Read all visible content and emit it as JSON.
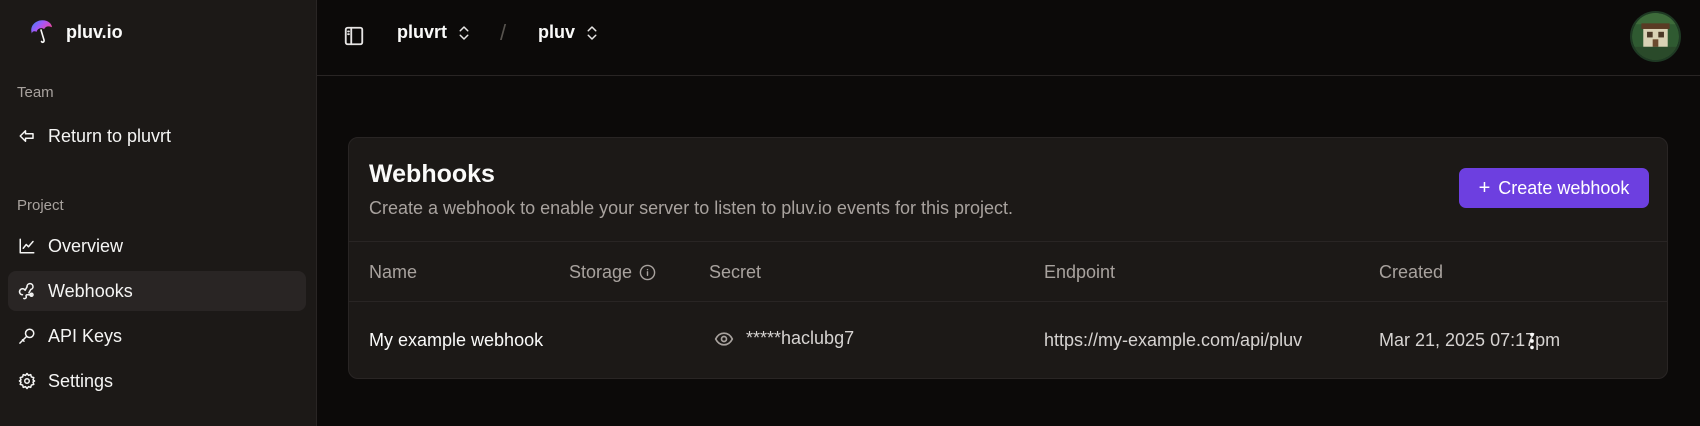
{
  "brand": {
    "name": "pluv.io",
    "logo_icon": "umbrella-logo-icon"
  },
  "sidebar": {
    "team_label": "Team",
    "return_label": "Return to pluvrt",
    "project_label": "Project",
    "items": [
      {
        "label": "Overview",
        "icon": "line-chart-icon",
        "active": false
      },
      {
        "label": "Webhooks",
        "icon": "webhook-icon",
        "active": true
      },
      {
        "label": "API Keys",
        "icon": "key-icon",
        "active": false
      },
      {
        "label": "Settings",
        "icon": "gear-icon",
        "active": false
      }
    ]
  },
  "topbar": {
    "team_switcher": "pluvrt",
    "separator": "/",
    "project_switcher": "pluv"
  },
  "webhooks": {
    "title": "Webhooks",
    "description": "Create a webhook to enable your server to listen to pluv.io events for this project.",
    "create_label": "Create webhook",
    "columns": [
      "Name",
      "Storage",
      "Secret",
      "Endpoint",
      "Created"
    ],
    "rows": [
      {
        "name": "My example webhook",
        "storage": "",
        "secret": "*****haclubg7",
        "endpoint": "https://my-example.com/api/pluv",
        "created": "Mar 21, 2025 07:17pm"
      }
    ]
  },
  "colors": {
    "background": "#0c0a09",
    "sidebar": "#1c1917",
    "accent": "#6d3fe0",
    "muted_text": "#a8a29e"
  }
}
